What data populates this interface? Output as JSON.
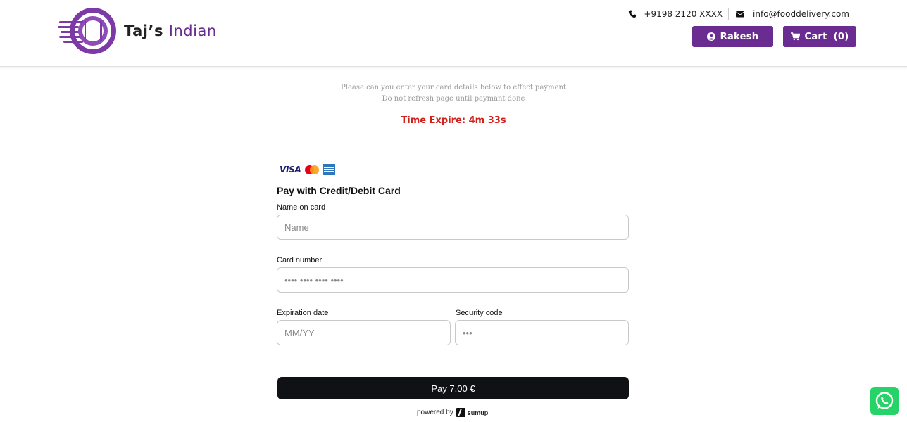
{
  "brand": {
    "name_part1": "Taj’s",
    "name_part2": "Indian",
    "primary_color": "#6b2c91"
  },
  "header": {
    "phone": "+9198 2120 XXXX",
    "email": "info@fooddelivery.com",
    "user_label": "Rakesh",
    "cart_label": "Cart",
    "cart_count": "(0)"
  },
  "payment": {
    "instruction_line1": "Please can you enter your card details below to effect payment",
    "instruction_line2": "Do not refresh page until paymant done",
    "timer_text": "Time Expire: 4m 33s",
    "card_brands": [
      "VISA",
      "mastercard-icon",
      "amex-icon"
    ],
    "visa_text": "VISA",
    "title": "Pay with Credit/Debit Card",
    "name_label": "Name on card",
    "name_placeholder": "Name",
    "card_number_label": "Card number",
    "card_number_placeholder": "•••• •••• •••• ••••",
    "expiry_label": "Expiration date",
    "expiry_placeholder": "MM/YY",
    "security_label": "Security code",
    "security_placeholder": "•••",
    "pay_button": "Pay 7.00 €",
    "powered_by": "powered by",
    "provider": "sumup"
  },
  "icons": [
    "phone-icon",
    "envelope-icon",
    "user-circle-icon",
    "shopping-cart-icon",
    "whatsapp-icon"
  ]
}
